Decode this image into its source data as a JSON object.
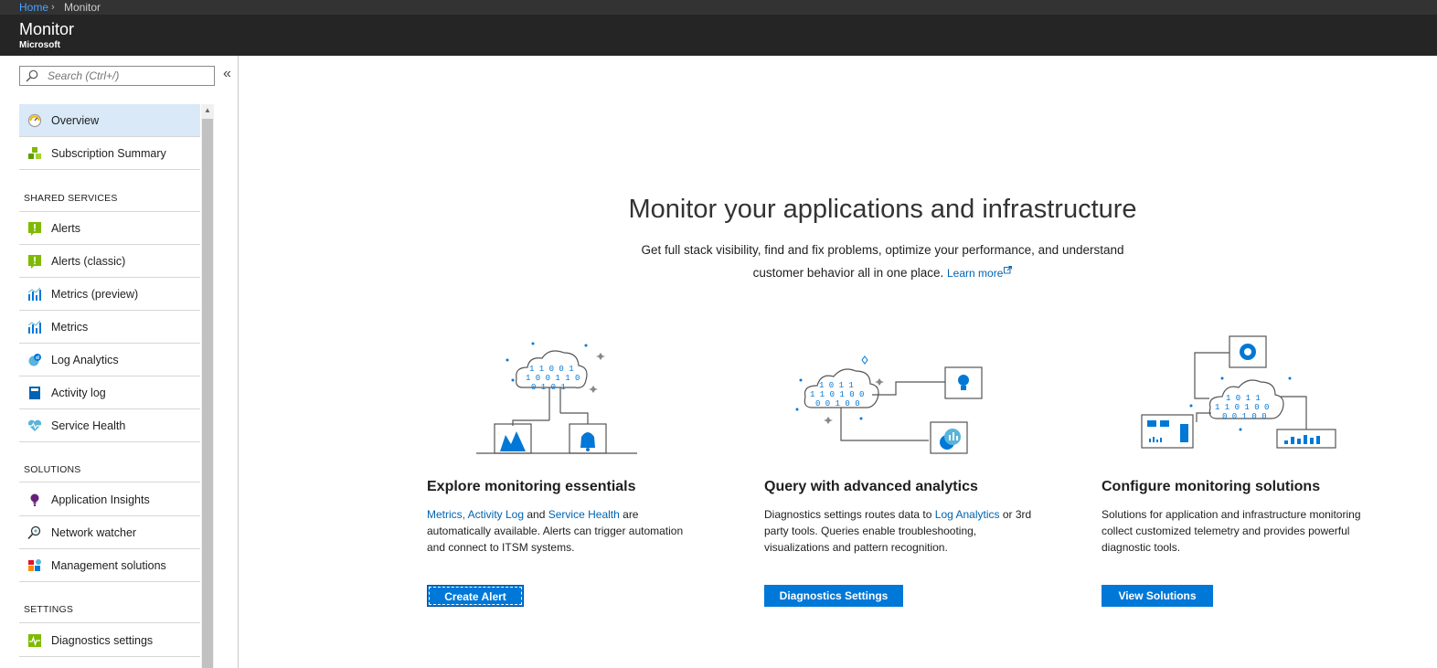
{
  "breadcrumb": {
    "home": "Home",
    "separator": "›",
    "current": "Monitor"
  },
  "header": {
    "title": "Monitor",
    "subtitle": "Microsoft"
  },
  "search": {
    "placeholder": "Search (Ctrl+/)"
  },
  "collapse_glyph": "«",
  "nav": {
    "top": [
      {
        "label": "Overview",
        "icon": "gauge-icon",
        "active": true
      },
      {
        "label": "Subscription Summary",
        "icon": "cubes-icon"
      }
    ],
    "shared_services_heading": "SHARED SERVICES",
    "shared_services": [
      {
        "label": "Alerts",
        "icon": "alert-icon"
      },
      {
        "label": "Alerts (classic)",
        "icon": "alert-icon"
      },
      {
        "label": "Metrics (preview)",
        "icon": "bar-chart-icon"
      },
      {
        "label": "Metrics",
        "icon": "bar-chart-icon"
      },
      {
        "label": "Log Analytics",
        "icon": "log-analytics-icon"
      },
      {
        "label": "Activity log",
        "icon": "book-icon"
      },
      {
        "label": "Service Health",
        "icon": "heart-icon"
      }
    ],
    "solutions_heading": "SOLUTIONS",
    "solutions": [
      {
        "label": "Application Insights",
        "icon": "lightbulb-icon"
      },
      {
        "label": "Network watcher",
        "icon": "network-icon"
      },
      {
        "label": "Management solutions",
        "icon": "solutions-icon"
      }
    ],
    "settings_heading": "SETTINGS",
    "settings": [
      {
        "label": "Diagnostics settings",
        "icon": "diagnostics-icon"
      }
    ]
  },
  "hero": {
    "title": "Monitor your applications and infrastructure",
    "desc_line1": "Get full stack visibility, find and fix problems, optimize your performance, and understand",
    "desc_line2": "customer behavior all in one place.",
    "learn_more": "Learn more"
  },
  "cards": [
    {
      "title": "Explore monitoring essentials",
      "link1": "Metrics,",
      "link2": "Activity Log",
      "mid": "and",
      "link3": "Service Health",
      "rest": "are automatically available. Alerts can trigger automation and connect to ITSM systems.",
      "button": "Create Alert"
    },
    {
      "title": "Query with advanced analytics",
      "pre": "Diagnostics settings routes data to",
      "link": "Log Analytics",
      "rest": "or 3rd party tools. Queries enable troubleshooting, visualizations and pattern recognition.",
      "button": "Diagnostics Settings"
    },
    {
      "title": "Configure monitoring solutions",
      "desc": "Solutions for application and infrastructure monitoring collect customized telemetry and provides powerful diagnostic tools.",
      "button": "View Solutions"
    }
  ],
  "colors": {
    "accent": "#0078d7",
    "link": "#0063b1",
    "header_bg": "#252525",
    "active_nav": "#d9e9f7"
  }
}
